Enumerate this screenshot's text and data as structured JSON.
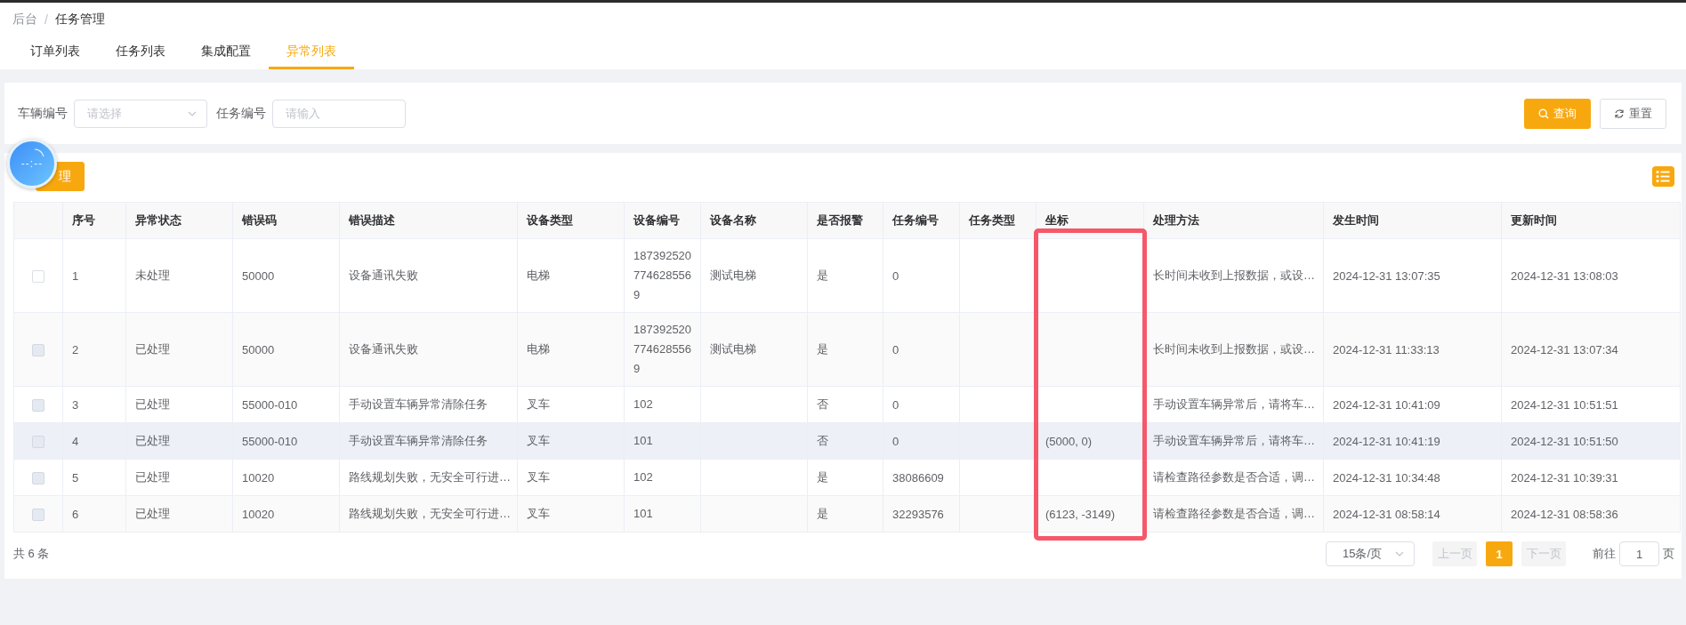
{
  "breadcrumb": [
    "后台",
    "任务管理"
  ],
  "breadcrumb_separator": "/",
  "tabs": [
    {
      "label": "订单列表",
      "selected": false
    },
    {
      "label": "任务列表",
      "selected": false
    },
    {
      "label": "集成配置",
      "selected": false
    },
    {
      "label": "异常列表",
      "selected": true
    }
  ],
  "filters": [
    {
      "kind": "select",
      "label": "车辆编号",
      "placeholder": "请选择"
    },
    {
      "kind": "input",
      "label": "任务编号",
      "placeholder": "请输入"
    }
  ],
  "filter_buttons": [
    {
      "kind": "primary",
      "label": "查询"
    },
    {
      "kind": "default",
      "label": "重置"
    }
  ],
  "toolbar_button": {
    "label": "理"
  },
  "timer_widget": {
    "text": "--:--"
  },
  "table": {
    "columns": [
      {
        "highlighted": false
      },
      {
        "label": "序号",
        "highlighted": false
      },
      {
        "label": "异常状态",
        "highlighted": false
      },
      {
        "label": "错误码",
        "highlighted": false
      },
      {
        "label": "错误描述",
        "highlighted": false
      },
      {
        "label": "设备类型",
        "highlighted": false
      },
      {
        "label": "设备编号",
        "highlighted": false
      },
      {
        "label": "设备名称",
        "highlighted": false
      },
      {
        "label": "是否报警",
        "highlighted": false
      },
      {
        "label": "任务编号",
        "highlighted": false
      },
      {
        "label": "任务类型",
        "highlighted": false
      },
      {
        "label": "坐标",
        "highlighted": true
      },
      {
        "label": "处理方法",
        "highlighted": false
      },
      {
        "label": "发生时间",
        "highlighted": false
      },
      {
        "label": "更新时间",
        "highlighted": false
      }
    ],
    "rows": [
      {
        "disabled": false,
        "hovered": false,
        "cells": [
          "",
          "1",
          "未处理",
          "50000",
          "设备通讯失败",
          "电梯",
          "1873925207746285569",
          "测试电梯",
          "是",
          "0",
          null,
          null,
          "长时间未收到上报数据，或设…",
          "2024-12-31 13:07:35",
          "2024-12-31 13:08:03"
        ]
      },
      {
        "disabled": true,
        "hovered": false,
        "cells": [
          "",
          "2",
          "已处理",
          "50000",
          "设备通讯失败",
          "电梯",
          "1873925207746285569",
          "测试电梯",
          "是",
          "0",
          null,
          null,
          "长时间未收到上报数据，或设…",
          "2024-12-31 11:33:13",
          "2024-12-31 13:07:34"
        ]
      },
      {
        "disabled": true,
        "hovered": false,
        "cells": [
          "",
          "3",
          "已处理",
          "55000-010",
          "手动设置车辆异常清除任务",
          "叉车",
          "102",
          null,
          "否",
          "0",
          null,
          null,
          "手动设置车辆异常后，请将车…",
          "2024-12-31 10:41:09",
          "2024-12-31 10:51:51"
        ]
      },
      {
        "disabled": true,
        "hovered": true,
        "cells": [
          "",
          "4",
          "已处理",
          "55000-010",
          "手动设置车辆异常清除任务",
          "叉车",
          "101",
          null,
          "否",
          "0",
          null,
          "(5000, 0)",
          "手动设置车辆异常后，请将车…",
          "2024-12-31 10:41:19",
          "2024-12-31 10:51:50"
        ]
      },
      {
        "disabled": true,
        "hovered": false,
        "cells": [
          "",
          "5",
          "已处理",
          "10020",
          "路线规划失败，无安全可行进…",
          "叉车",
          "102",
          null,
          "是",
          "38086609",
          null,
          null,
          "请检查路径参数是否合适，调…",
          "2024-12-31 10:34:48",
          "2024-12-31 10:39:31"
        ]
      },
      {
        "disabled": true,
        "hovered": false,
        "cells": [
          "",
          "6",
          "已处理",
          "10020",
          "路线规划失败，无安全可行进…",
          "叉车",
          "101",
          null,
          "是",
          "32293576",
          null,
          "(6123, -3149)",
          "请检查路径参数是否合适，调…",
          "2024-12-31 08:58:14",
          "2024-12-31 08:58:36"
        ]
      }
    ]
  },
  "footer": {
    "total": "共 6 条",
    "page_size": "15条/页",
    "prev": "上一页",
    "pages": [
      {
        "label": "1",
        "selected": true
      }
    ],
    "next": "下一页",
    "goto_label": "前往",
    "goto_value": "1",
    "goto_suffix": "页"
  }
}
